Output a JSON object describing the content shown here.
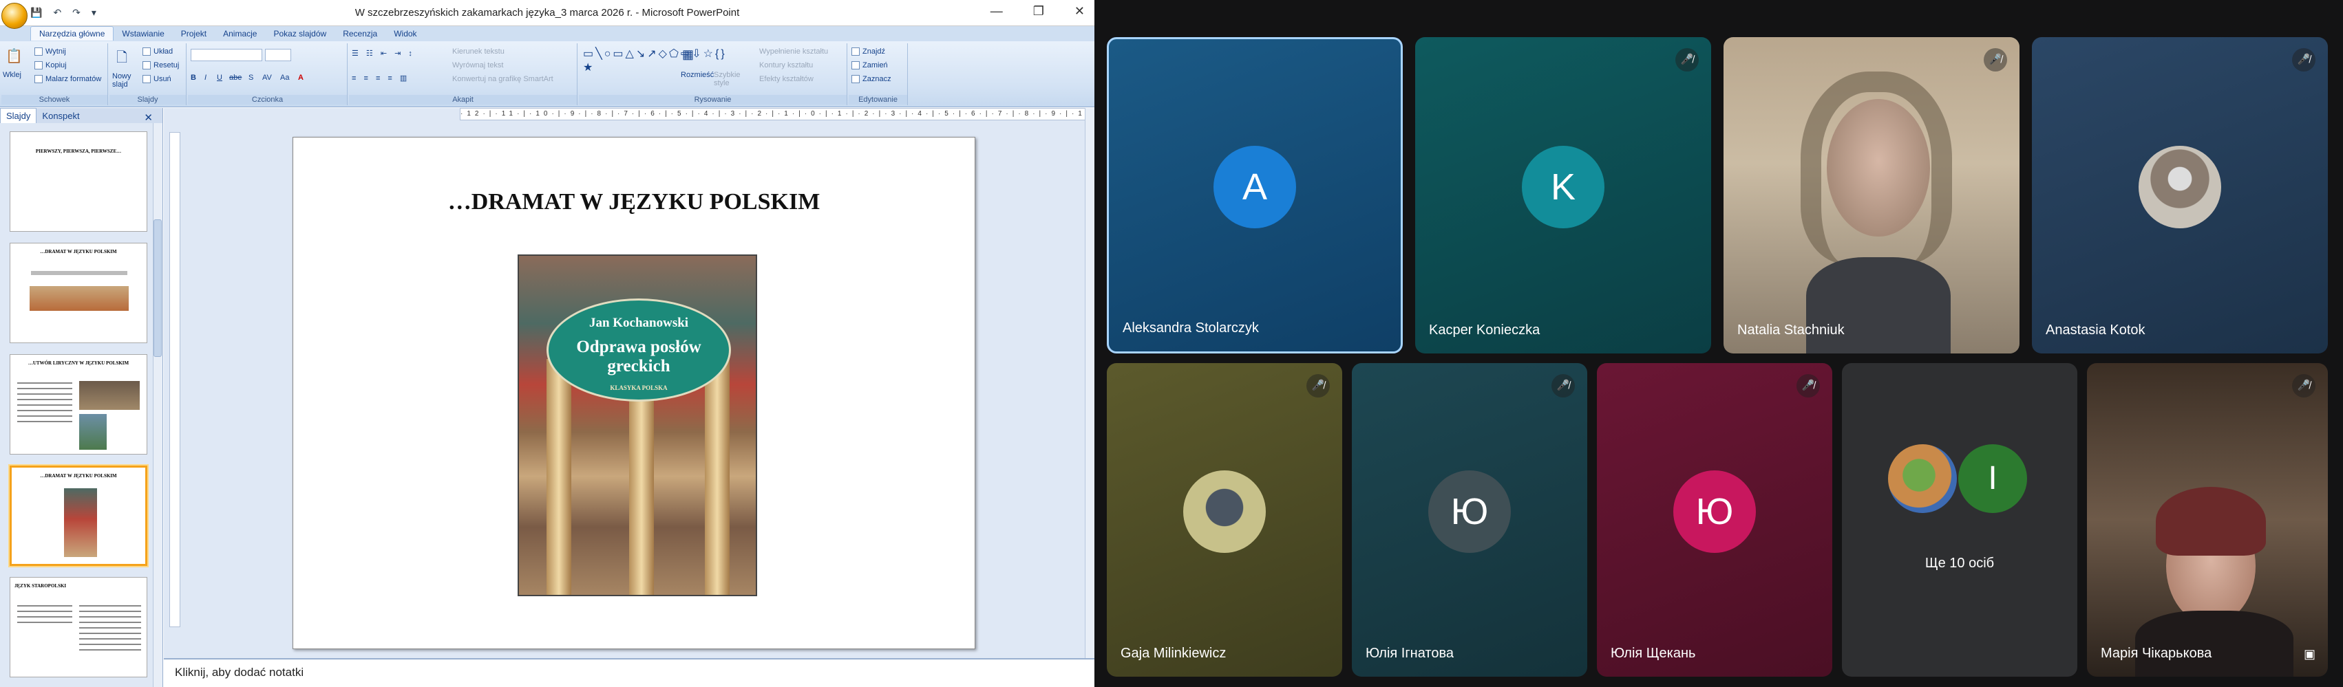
{
  "window": {
    "title": "W szczebrzeszyńskich zakamarkach języka_3 marca 2026 r. - Microsoft PowerPoint",
    "minimize": "—",
    "restore": "❐",
    "close": "✕"
  },
  "ribbon_tabs": [
    "Narzędzia główne",
    "Wstawianie",
    "Projekt",
    "Animacje",
    "Pokaz slajdów",
    "Recenzja",
    "Widok"
  ],
  "ribbon": {
    "clipboard": {
      "paste": "Wklej",
      "cut": "Wytnij",
      "copy": "Kopiuj",
      "format_painter": "Malarz formatów",
      "label": "Schowek"
    },
    "slides": {
      "new_slide": "Nowy slajd",
      "layout": "Układ",
      "reset": "Resetuj",
      "delete": "Usuń",
      "label": "Slajdy"
    },
    "font": {
      "label": "Czcionka",
      "bold": "B",
      "italic": "I",
      "underline": "U",
      "strike": "abe",
      "shadow": "S",
      "spacing": "AV",
      "case": "Aa",
      "color": "A"
    },
    "paragraph": {
      "text_direction": "Kierunek tekstu",
      "align_text": "Wyrównaj tekst",
      "smartart": "Konwertuj na grafikę SmartArt",
      "label": "Akapit"
    },
    "drawing": {
      "arrange": "Rozmieść",
      "quick_styles": "Szybkie style",
      "fill": "Wypełnienie kształtu",
      "outline": "Kontury kształtu",
      "effects": "Efekty kształtów",
      "label": "Rysowanie"
    },
    "editing": {
      "find": "Znajdź",
      "replace": "Zamień",
      "select": "Zaznacz",
      "label": "Edytowanie"
    }
  },
  "left_panel": {
    "tab_slides": "Slajdy",
    "tab_outline": "Konspekt",
    "close": "✕",
    "thumbs": [
      {
        "num": "",
        "title": "PIERWSZY, PIERWSZA, PIERWSZE…"
      },
      {
        "num": "",
        "title": "…DRAMAT W JĘZYKU POLSKIM"
      },
      {
        "num": "",
        "title": "…UTWÓR LIRYCZNY W JĘZYKU POLSKIM"
      },
      {
        "num": "",
        "title": "…DRAMAT W JĘZYKU POLSKIM"
      },
      {
        "num": "",
        "title": "JĘZYK STAROPOLSKI"
      }
    ]
  },
  "ruler_text": "·12·|·11·|·10·|·9·|·8·|·7·|·6·|·5·|·4·|·3·|·2·|·1·|·0·|·1·|·2·|·3·|·4·|·5·|·6·|·7·|·8·|·9·|·10·|·11·|·12·",
  "slide": {
    "title": "…DRAMAT W JĘZYKU POLSKIM",
    "book_author": "Jan Kochanowski",
    "book_title": "Odprawa posłów greckich",
    "book_series": "KLASYKA POLSKA"
  },
  "notes_placeholder": "Kliknij, aby dodać notatki",
  "meet": {
    "participants": [
      {
        "name": "Aleksandra Stolarczyk",
        "initial": "A",
        "muted": false,
        "color": "#1a7fd6",
        "active": true
      },
      {
        "name": "Kacper Konieczka",
        "initial": "K",
        "muted": true,
        "color": "#128d9a"
      },
      {
        "name": "Natalia Stachniuk",
        "video": true,
        "muted": true
      },
      {
        "name": "Anastasia Kotok",
        "avatar": "cat-photo",
        "muted": true
      },
      {
        "name": "Gaja Milinkiewicz",
        "avatar": "helmet-photo",
        "muted": true
      },
      {
        "name": "Юлія Ігнатова",
        "initial": "Ю",
        "muted": true,
        "color": "#3f4f55"
      },
      {
        "name": "Юлія Щекань",
        "initial": "Ю",
        "muted": true,
        "color": "#c8175e"
      },
      {
        "name": "Марія Чікарькова",
        "video": true,
        "muted": true
      }
    ],
    "more_label": "Ще 10 осіб",
    "more_initial": "I",
    "mic_icon": "🎙",
    "muted_icon": "mic-off-icon",
    "pin_icon": "▣"
  }
}
